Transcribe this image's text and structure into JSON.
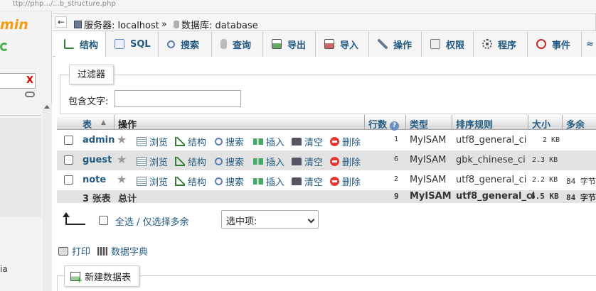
{
  "browser": {
    "url_fragment": "ttp://php.../...b_structure.php"
  },
  "nav": {
    "logo_text": "min",
    "filter_clear": "X",
    "tail_text": "ia"
  },
  "breadcrumb": {
    "collapse": "←",
    "server": "服务器: localhost",
    "separator": "»",
    "database": "数据库: database"
  },
  "tabs": [
    {
      "label": "结构",
      "active": true
    },
    {
      "label": "SQL"
    },
    {
      "label": "搜索"
    },
    {
      "label": "查询"
    },
    {
      "label": "导出"
    },
    {
      "label": "导入"
    },
    {
      "label": "操作"
    },
    {
      "label": "权限"
    },
    {
      "label": "程序"
    },
    {
      "label": "事件"
    },
    {
      "label": "≈"
    }
  ],
  "filter": {
    "legend": "过滤器",
    "label": "包含文字:",
    "value": ""
  },
  "table": {
    "headers": {
      "table": "表",
      "sort": "▲",
      "action": "操作",
      "rows": "行数",
      "help": "?",
      "type": "类型",
      "collation": "排序规则",
      "size": "大小",
      "overhead": "多余"
    },
    "actions": {
      "browse": "浏览",
      "structure": "结构",
      "search": "搜索",
      "insert": "插入",
      "empty": "清空",
      "drop": "删除"
    },
    "rows": [
      {
        "name": "admin",
        "rows": "1",
        "type": "MyISAM",
        "collation": "utf8_general_ci",
        "size": "2 KB",
        "overhead": ""
      },
      {
        "name": "guest",
        "rows": "6",
        "type": "MyISAM",
        "collation": "gbk_chinese_ci",
        "size": "2.3 KB",
        "overhead": ""
      },
      {
        "name": "note",
        "rows": "2",
        "type": "MyISAM",
        "collation": "utf8_general_ci",
        "size": "2.2 KB",
        "overhead": "84 字节"
      }
    ],
    "summary": {
      "count": "3 张表",
      "label": "总计",
      "rows": "9",
      "type": "MyISAM",
      "collation": "utf8_general_ci",
      "size": "6.5 KB",
      "overhead": "84 字节"
    }
  },
  "bulk": {
    "label": "全选 / 仅选择多余",
    "select_value": "选中项:"
  },
  "links": {
    "print": "打印",
    "dictionary": "数据字典"
  },
  "new_table": {
    "label": "新建数据表"
  }
}
